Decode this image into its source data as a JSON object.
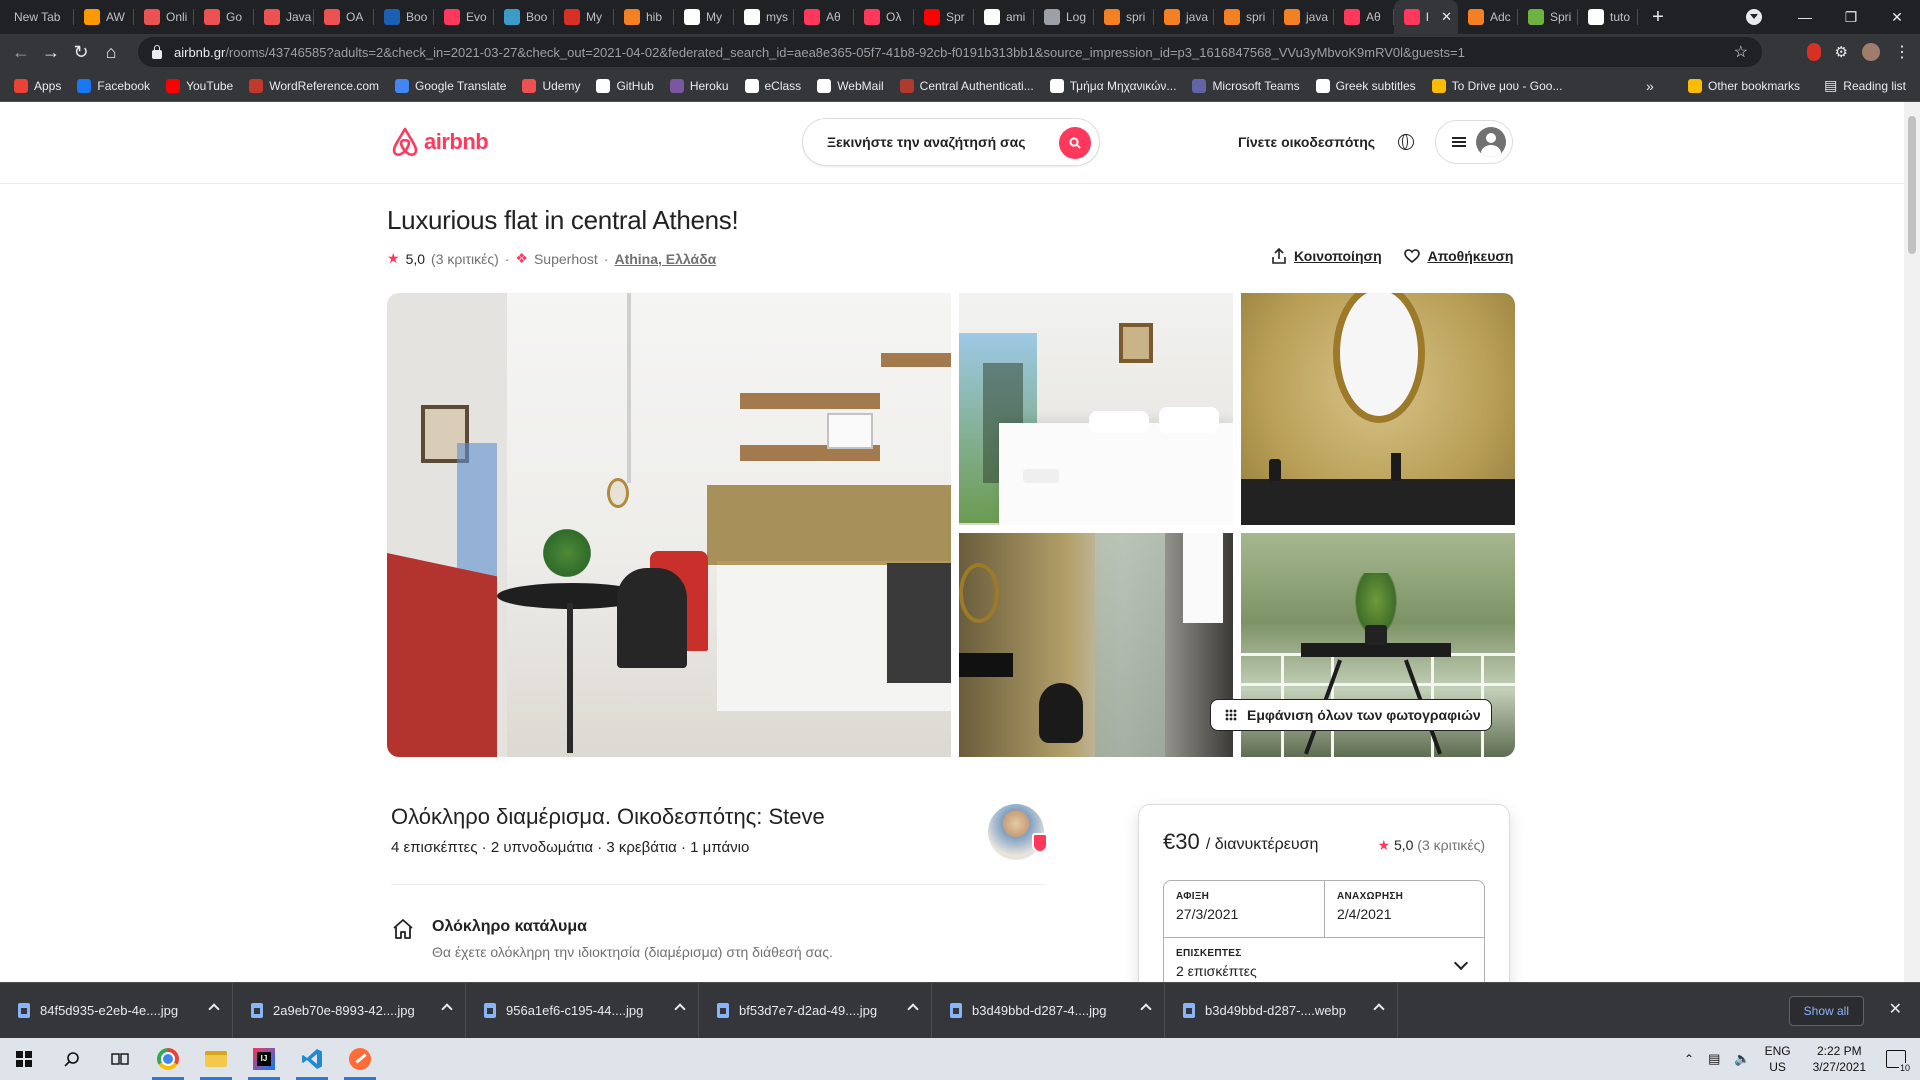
{
  "browser": {
    "tabs": [
      {
        "label": "New Tab",
        "icon": "none"
      },
      {
        "label": "AW",
        "icon": "aws-icon",
        "color": "#ff9900"
      },
      {
        "label": "Onli",
        "icon": "udemy-icon",
        "color": "#ec5252"
      },
      {
        "label": "Go",
        "icon": "udemy-icon",
        "color": "#ec5252"
      },
      {
        "label": "Java",
        "icon": "udemy-icon",
        "color": "#ec5252"
      },
      {
        "label": "OA",
        "icon": "udemy-icon",
        "color": "#ec5252"
      },
      {
        "label": "Boo",
        "icon": "b-icon",
        "color": "#1a5fb4"
      },
      {
        "label": "Evo",
        "icon": "airbnb-icon",
        "color": "#ff385c"
      },
      {
        "label": "Boo",
        "icon": "gear-icon",
        "color": "#3b9cc9"
      },
      {
        "label": "My",
        "icon": "gmail-icon",
        "color": "#d93025"
      },
      {
        "label": "hib",
        "icon": "stackoverflow-icon",
        "color": "#f48024"
      },
      {
        "label": "My",
        "icon": "doc-icon",
        "color": "#ffffff"
      },
      {
        "label": "mys",
        "icon": "google-icon",
        "color": "#ffffff"
      },
      {
        "label": "Αθ",
        "icon": "airbnb-icon",
        "color": "#ff385c"
      },
      {
        "label": "Ολ",
        "icon": "airbnb-icon",
        "color": "#ff385c"
      },
      {
        "label": "Spr",
        "icon": "youtube-icon",
        "color": "#ff0000"
      },
      {
        "label": "ami",
        "icon": "github-icon",
        "color": "#ffffff"
      },
      {
        "label": "Log",
        "icon": "globe-icon",
        "color": "#9aa0a6"
      },
      {
        "label": "spri",
        "icon": "stackoverflow-icon",
        "color": "#f48024"
      },
      {
        "label": "java",
        "icon": "stackoverflow-icon",
        "color": "#f48024"
      },
      {
        "label": "spri",
        "icon": "stackoverflow-icon",
        "color": "#f48024"
      },
      {
        "label": "java",
        "icon": "stackoverflow-icon",
        "color": "#f48024"
      },
      {
        "label": "Αθ",
        "icon": "airbnb-icon",
        "color": "#ff385c"
      },
      {
        "label": "l",
        "icon": "airbnb-icon",
        "color": "#ff385c",
        "active": true
      },
      {
        "label": "Adc",
        "icon": "stackoverflow-icon",
        "color": "#f48024"
      },
      {
        "label": "Spri",
        "icon": "spring-icon",
        "color": "#6db33f"
      },
      {
        "label": "tuto",
        "icon": "github-icon",
        "color": "#ffffff"
      }
    ],
    "url_host": "airbnb.gr",
    "url_path": "/rooms/43746585?adults=2&check_in=2021-03-27&check_out=2021-04-02&federated_search_id=aea8e365-05f7-41b8-92cb-f0191b313bb1&source_impression_id=p3_1616847568_VVu3yMbvoK9mRV0l&guests=1",
    "bookmarks": [
      {
        "label": "Apps",
        "icon": "apps-icon",
        "color": "#ea4335"
      },
      {
        "label": "Facebook",
        "icon": "facebook-icon",
        "color": "#1877f2"
      },
      {
        "label": "YouTube",
        "icon": "youtube-icon",
        "color": "#ff0000"
      },
      {
        "label": "WordReference.com",
        "icon": "wordreference-icon",
        "color": "#c0392b"
      },
      {
        "label": "Google Translate",
        "icon": "translate-icon",
        "color": "#4285f4"
      },
      {
        "label": "Udemy",
        "icon": "udemy-icon",
        "color": "#ec5252"
      },
      {
        "label": "GitHub",
        "icon": "github-icon",
        "color": "#ffffff"
      },
      {
        "label": "Heroku",
        "icon": "heroku-icon",
        "color": "#79589f"
      },
      {
        "label": "eClass",
        "icon": "eclass-icon",
        "color": "#ffffff"
      },
      {
        "label": "WebMail",
        "icon": "webmail-icon",
        "color": "#ffffff"
      },
      {
        "label": "Central Authenticati...",
        "icon": "university-icon",
        "color": "#b03a2e"
      },
      {
        "label": "Τμήμα Μηχανικών...",
        "icon": "department-icon",
        "color": "#ffffff"
      },
      {
        "label": "Microsoft Teams",
        "icon": "teams-icon",
        "color": "#6264a7"
      },
      {
        "label": "Greek subtitles",
        "icon": "subtitles-icon",
        "color": "#ffffff"
      },
      {
        "label": "To Drive μου - Goo...",
        "icon": "drive-icon",
        "color": "#fbbc04"
      }
    ],
    "bookmarks_more": "»",
    "other_bookmarks": "Other bookmarks",
    "reading_list": "Reading list"
  },
  "airbnb": {
    "logo_text": "airbnb",
    "search_placeholder": "Ξεκινήστε την αναζήτησή σας",
    "become_host": "Γίνετε οικοδεσπότης",
    "listing_title": "Luxurious flat in central Athens!",
    "rating": "5,0",
    "reviews": "(3 κριτικές)",
    "superhost": "Superhost",
    "location": "Athina, Ελλάδα",
    "share": "Κοινοποίηση",
    "save": "Αποθήκευση",
    "show_all_photos": "Εμφάνιση όλων των φωτογραφιών",
    "subtitle": "Ολόκληρο διαμέρισμα. Οικοδεσπότης: Steve",
    "facts": "4 επισκέπτες · 2 υπνοδωμάτια · 3 κρεβάτια · 1 μπάνιο",
    "feature_title": "Ολόκληρο κατάλυμα",
    "feature_desc": "Θα έχετε ολόκληρη την ιδιοκτησία (διαμέρισμα) στη διάθεσή σας.",
    "price": "€30",
    "per_night": "/ διανυκτέρευση",
    "checkin_label": "ΑΦΙΞΗ",
    "checkin_value": "27/3/2021",
    "checkout_label": "ΑΝΑΧΩΡΗΣΗ",
    "checkout_value": "2/4/2021",
    "guests_label": "ΕΠΙΣΚΕΠΤΕΣ",
    "guests_value": "2 επισκέπτες",
    "brand_color": "#ff385c"
  },
  "downloads": [
    {
      "name": "84f5d935-e2eb-4e....jpg"
    },
    {
      "name": "2a9eb70e-8993-42....jpg"
    },
    {
      "name": "956a1ef6-c195-44....jpg"
    },
    {
      "name": "bf53d7e7-d2ad-49....jpg"
    },
    {
      "name": "b3d49bbd-d287-4....jpg"
    },
    {
      "name": "b3d49bbd-d287-....webp"
    }
  ],
  "downloads_show_all": "Show all",
  "taskbar": {
    "lang": "ENG",
    "region": "US",
    "time": "2:22 PM",
    "date": "3/27/2021",
    "notifications": "10"
  }
}
